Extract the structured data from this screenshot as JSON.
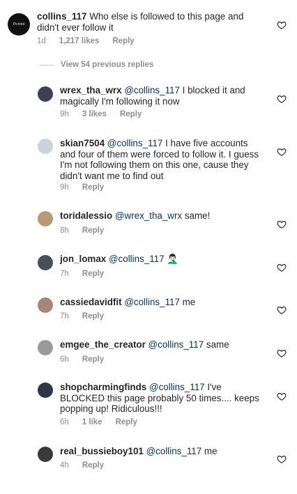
{
  "parent": {
    "avatar_text": "Pivoted",
    "username": "collins_117",
    "text": "Who else is followed to this page and didn't ever follow it",
    "time": "1d",
    "likes": "1,217 likes",
    "reply": "Reply"
  },
  "view_previous": "View 54 previous replies",
  "replies": [
    {
      "username": "wrex_tha_wrx",
      "mention": "@collins_117",
      "text": "I blocked it and magically I'm following it now",
      "time": "9h",
      "likes": "3 likes",
      "reply": "Reply",
      "avatar_color": "#3c4254"
    },
    {
      "username": "skian7504",
      "mention": "@collins_117",
      "text": "I have five accounts and four of them were forced to follow it. I guess I'm not following them on this one, cause they didn't want me to find out",
      "time": "9h",
      "likes": "",
      "reply": "Reply",
      "avatar_color": "#c9d4d8"
    },
    {
      "username": "toridalessio",
      "mention": "@wrex_tha_wrx",
      "text": "same!",
      "time": "8h",
      "likes": "",
      "reply": "Reply",
      "avatar_color": "#b99a72"
    },
    {
      "username": "jon_lomax",
      "mention": "@collins_117",
      "text": "🤦🏻‍♂️",
      "time": "7h",
      "likes": "",
      "reply": "Reply",
      "avatar_color": "#4a4f58"
    },
    {
      "username": "cassiedavidfit",
      "mention": "@collins_117",
      "text": "me",
      "time": "7h",
      "likes": "",
      "reply": "Reply",
      "avatar_color": "#a88576"
    },
    {
      "username": "emgee_the_creator",
      "mention": "@collins_117",
      "text": "same",
      "time": "6h",
      "likes": "",
      "reply": "Reply",
      "avatar_color": "#9a9a9a"
    },
    {
      "username": "shopcharmingfinds",
      "mention": "@collins_117",
      "text": "I've BLOCKED this page probably 50 times.... keeps popping up! Ridiculous!!!",
      "time": "6h",
      "likes": "1 like",
      "reply": "Reply",
      "avatar_color": "#2f3744"
    },
    {
      "username": "real_bussieboy101",
      "mention": "@collins_117",
      "text": "me",
      "time": "4h",
      "likes": "",
      "reply": "Reply",
      "avatar_color": "#3a3a3a"
    }
  ]
}
